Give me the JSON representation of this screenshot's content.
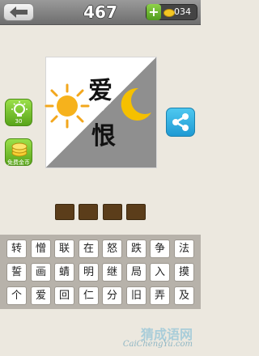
{
  "header": {
    "level": "467",
    "coins": "034",
    "plus_label": "+"
  },
  "puzzle": {
    "char_top": "爱",
    "char_bottom": "恨"
  },
  "hints": {
    "hint_cost": "30",
    "free_coins_label": "免费金币"
  },
  "answer_slots": 4,
  "keyboard": {
    "row1": [
      "转",
      "憎",
      "联",
      "在",
      "怒",
      "跌",
      "争",
      "法"
    ],
    "row2": [
      "誓",
      "画",
      "蜻",
      "明",
      "继",
      "局",
      "入",
      "摸"
    ],
    "row3": [
      "个",
      "爱",
      "回",
      "仁",
      "分",
      "旧",
      "弄",
      "及"
    ]
  },
  "watermark": {
    "cn": "猜成语网",
    "en": "CaiChengYu.com"
  },
  "colors": {
    "header": "#7d7d7d",
    "answer_slot": "#5b3d1a",
    "green_button": "#6bb726",
    "share_button": "#2aa6dd",
    "sun": "#f2a71d",
    "moon": "#f5c000"
  }
}
